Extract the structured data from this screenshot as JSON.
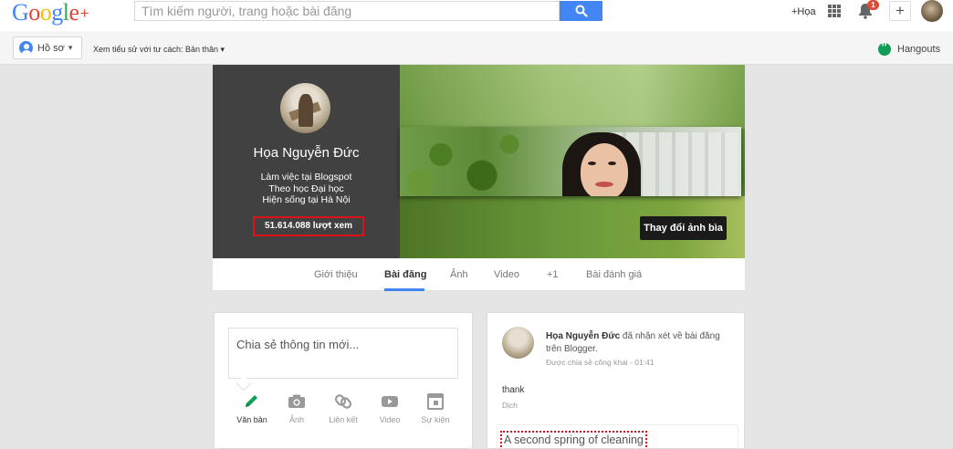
{
  "topbar": {
    "logo": {
      "g1": "G",
      "o1": "o",
      "o2": "o",
      "g2": "g",
      "l": "l",
      "e": "e",
      "plus": "+"
    },
    "search_placeholder": "Tìm kiếm người, trang hoặc bài đăng",
    "plus_name": "+Họa",
    "notification_count": "1",
    "share_label": "+"
  },
  "subbar": {
    "profile_label": "Hồ sơ",
    "view_as": "Xem tiểu sử với tư cách: Bản thân",
    "hangouts": "Hangouts"
  },
  "profile": {
    "name": "Họa Nguyễn Đức",
    "work": "Làm việc tại Blogspot",
    "study": "Theo học Đại học",
    "lives": "Hiện sống tại Hà Nội",
    "views": "51.614.088 lượt xem",
    "change_cover": "Thay đổi ảnh bìa"
  },
  "tabs": [
    {
      "label": "Giới thiệu",
      "active": false
    },
    {
      "label": "Bài đăng",
      "active": true
    },
    {
      "label": "Ảnh",
      "active": false
    },
    {
      "label": "Video",
      "active": false
    },
    {
      "label": "+1",
      "active": false
    },
    {
      "label": "Bài đánh giá",
      "active": false
    }
  ],
  "share_box": {
    "placeholder": "Chia sẻ thông tin mới...",
    "actions": [
      {
        "label": "Văn bản",
        "icon": "pencil-icon",
        "active": true
      },
      {
        "label": "Ảnh",
        "icon": "camera-icon",
        "active": false
      },
      {
        "label": "Liên kết",
        "icon": "link-icon",
        "active": false
      },
      {
        "label": "Video",
        "icon": "video-icon",
        "active": false
      },
      {
        "label": "Sự kiện",
        "icon": "event-icon",
        "active": false
      }
    ]
  },
  "post": {
    "author": "Họa Nguyễn Đức",
    "action": " đã nhận xét về bài đăng trên Blogger.",
    "shared": "Được chia sẻ công khai",
    "time": "01:41",
    "text": "thank",
    "translate": "Dịch",
    "inner_title": "A second spring of cleaning"
  },
  "colors": {
    "google_blue": "#4285f4",
    "google_red": "#dd4b39",
    "highlight_red": "#e0101b",
    "pencil_green": "#0f9d58"
  }
}
